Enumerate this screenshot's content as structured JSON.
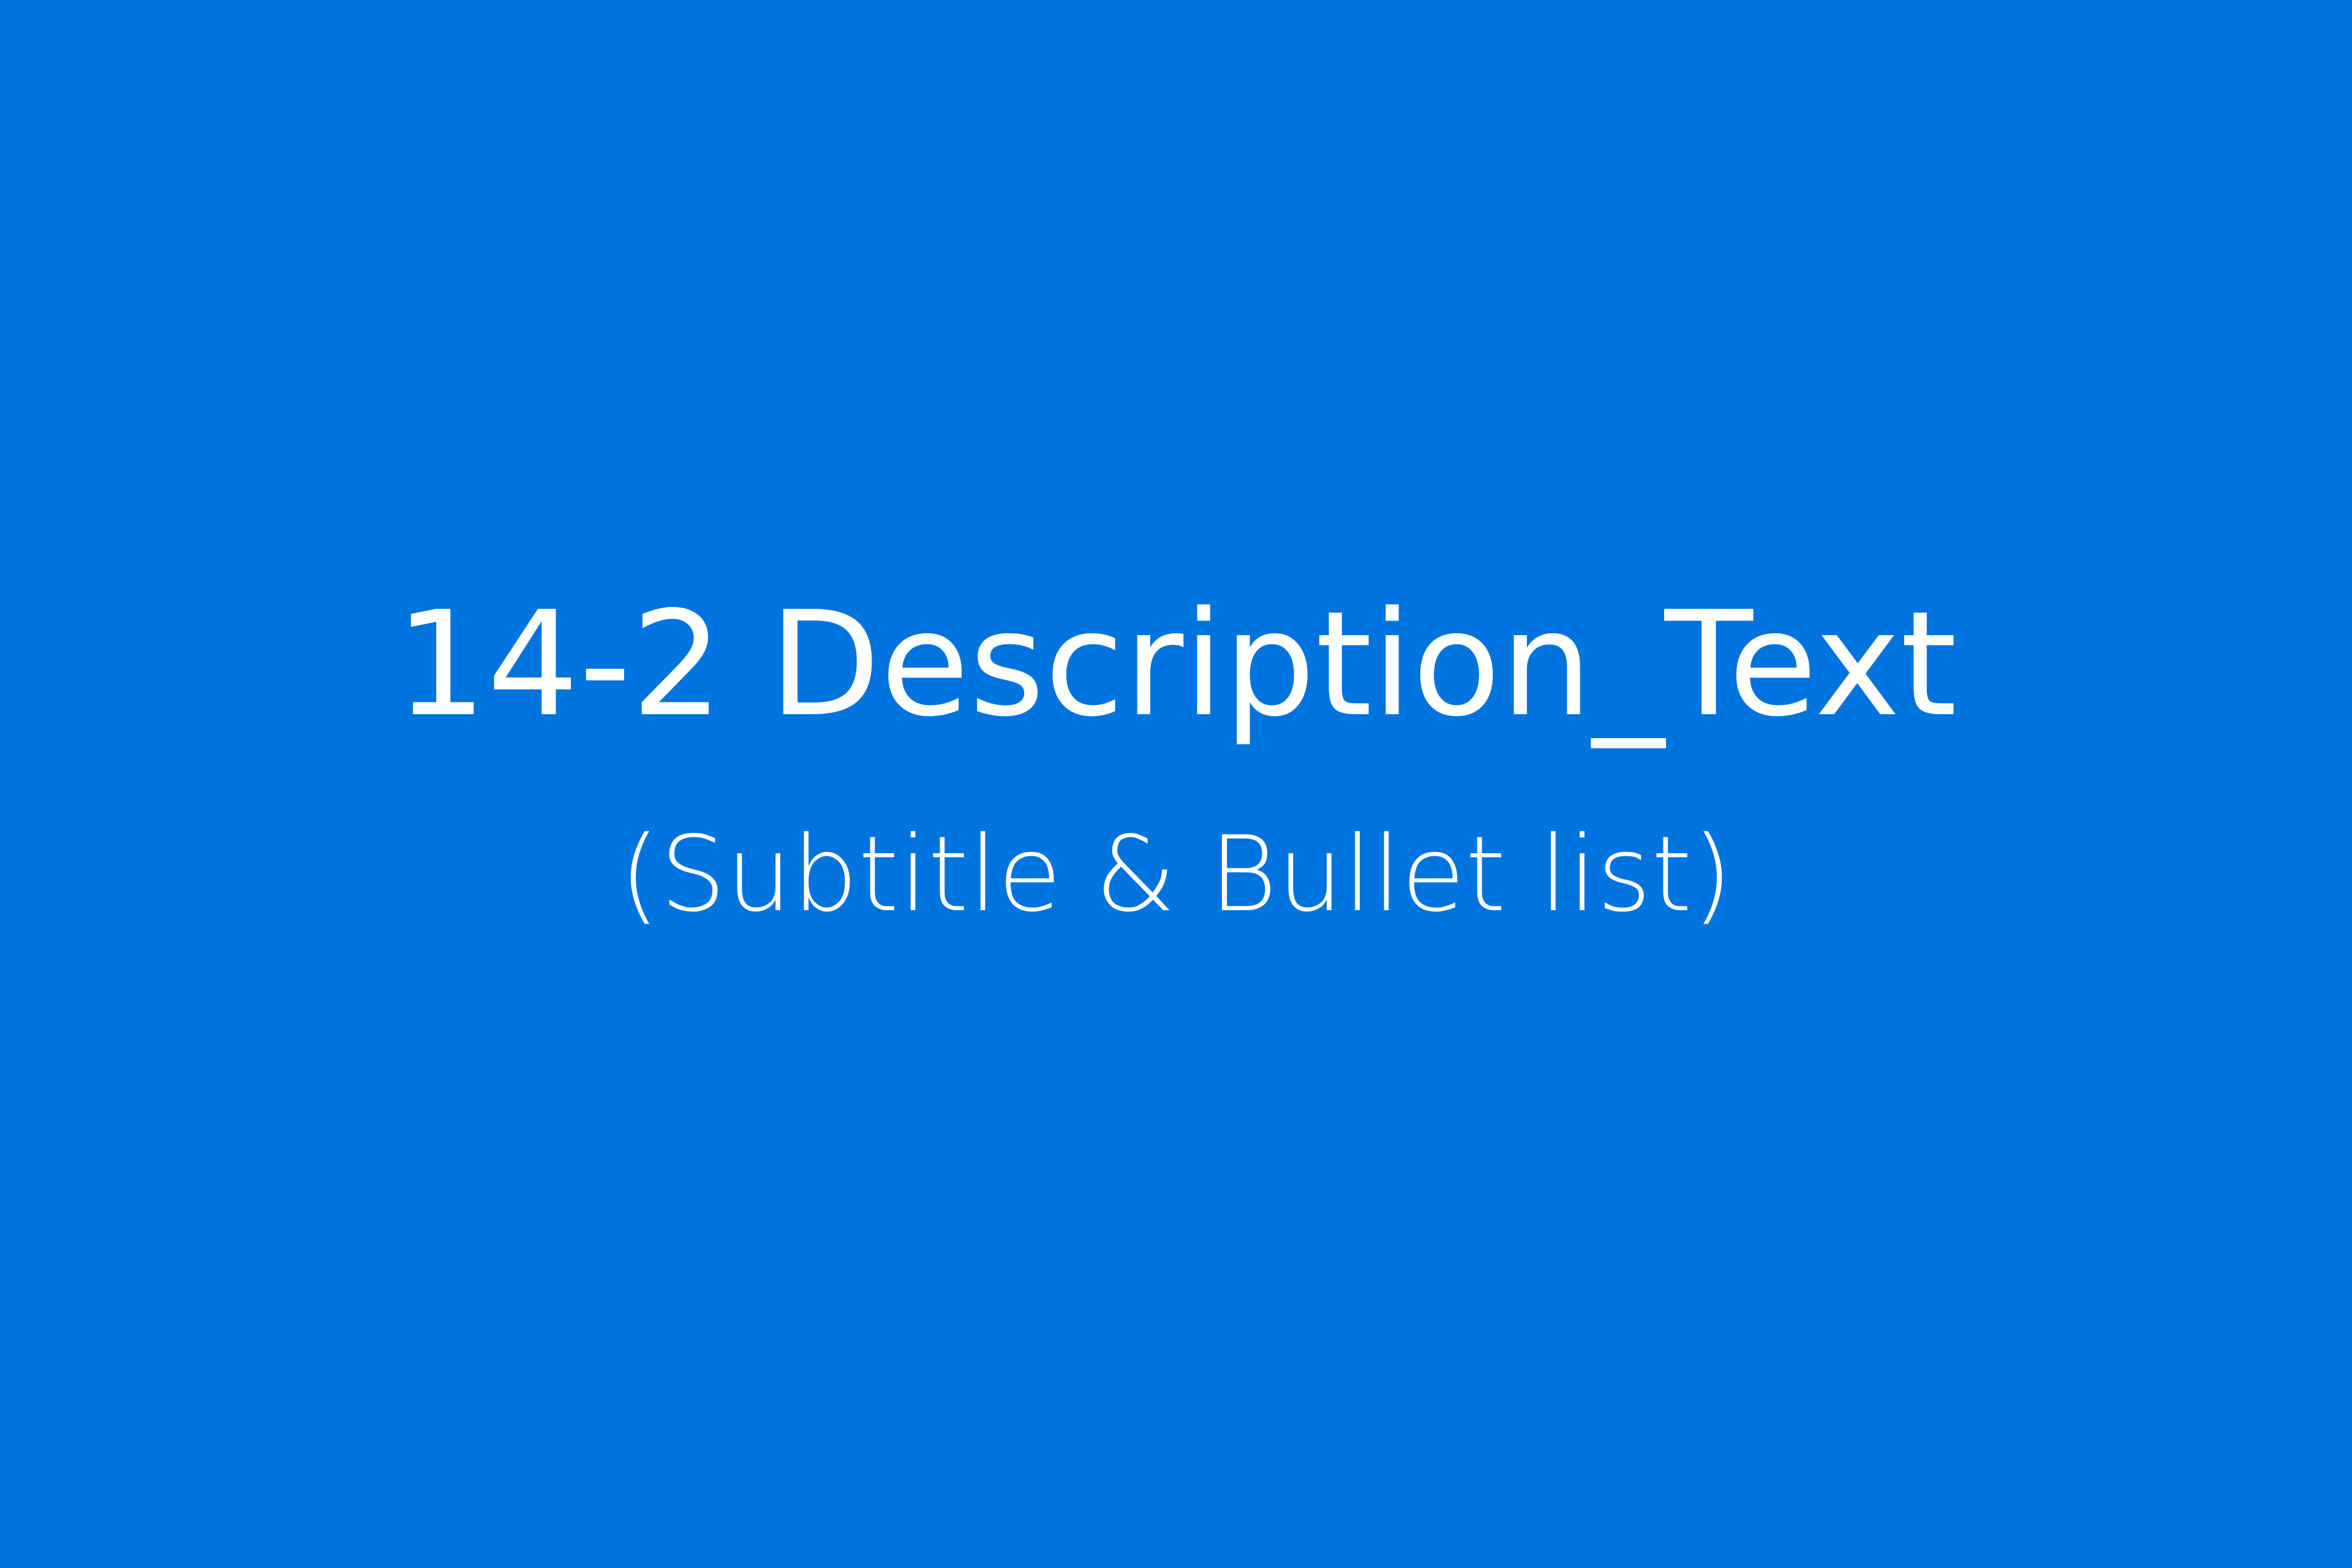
{
  "slide": {
    "title": "14-2 Description_Text",
    "subtitle": "(Subtitle & Bullet list)",
    "background_color": "#0074DE",
    "text_color": "#FFFFFF"
  }
}
